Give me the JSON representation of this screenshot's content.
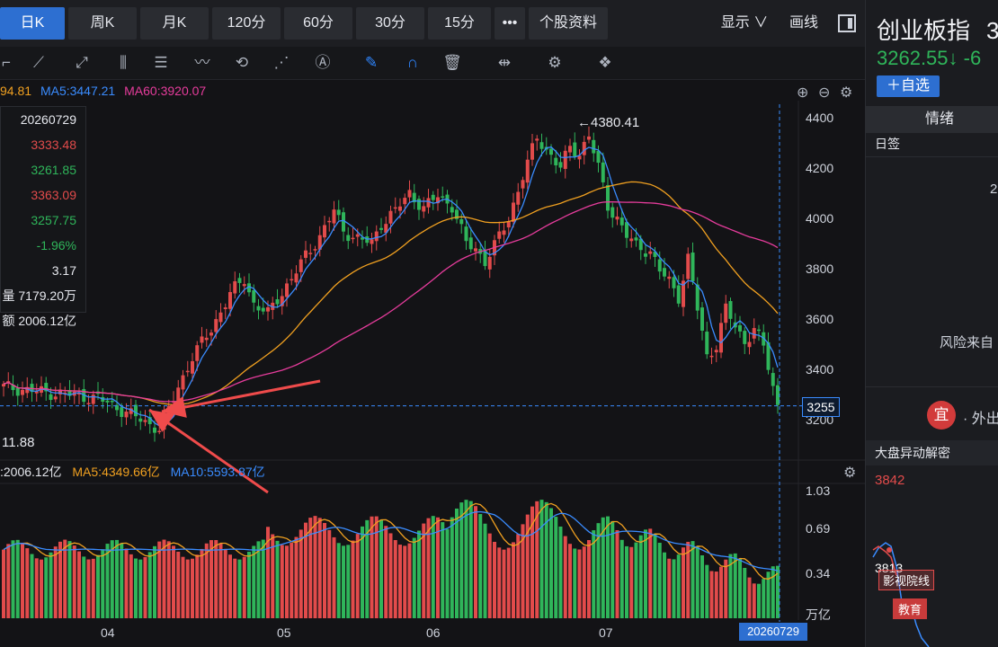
{
  "tabs": [
    "日K",
    "周K",
    "月K",
    "120分",
    "60分",
    "30分",
    "15分",
    "•••",
    "个股资料"
  ],
  "tab_right": {
    "display": "显示 ∨",
    "draw": "画线"
  },
  "ma_bar": {
    "ma_partial": "94.81",
    "ma5": "MA5:3447.21",
    "ma60": "MA60:3920.07"
  },
  "info": {
    "date": "20260729",
    "open": "3333.48",
    "high": "3261.85",
    "low": "3363.09",
    "close": "3257.75",
    "change": "-1.96%",
    "amplitude": "3.17",
    "volume": "7179.20万",
    "amount": "2006.12亿",
    "volume_prefix": "量",
    "amount_prefix": "额"
  },
  "annotations": {
    "high_label": "←4380.41",
    "low_label": "11.88"
  },
  "price_axis": [
    "4400",
    "4200",
    "4000",
    "3800",
    "3600",
    "3400",
    "3200"
  ],
  "current_price_box": "3255",
  "volume_bar": {
    "vol": ":2006.12亿",
    "ma5": "MA5:4349.66亿",
    "ma10": "MA10:5593.87亿"
  },
  "volume_axis": [
    "1.03",
    "0.69",
    "0.34",
    "万亿"
  ],
  "x_axis": [
    "04",
    "05",
    "06",
    "07"
  ],
  "date_box": "20260729",
  "right_panel": {
    "title": "创业板指",
    "title_tail": "3",
    "price": "3262.55↓ -6",
    "add_btn": "＋自选",
    "tab": "情绪",
    "sub": "日签",
    "digit": "2",
    "risk": "风险来自",
    "yi": "宜",
    "outside": "· 外出",
    "section": "大盘异动解密",
    "v1": "3842",
    "v2": "3813",
    "tag1": "影视院线",
    "tag2": "教育"
  },
  "chart_data": {
    "type": "candlestick",
    "y_axis_range": [
      3100,
      4450
    ],
    "high_annotation": 4380.41,
    "current_price": 3255
  },
  "colors": {
    "up": "#e24b4b",
    "down": "#2fb55a",
    "accent": "#2d6fd1",
    "ma5": "#3a8cff",
    "ma60": "#e63c9c",
    "ma_orange": "#f0a020"
  }
}
